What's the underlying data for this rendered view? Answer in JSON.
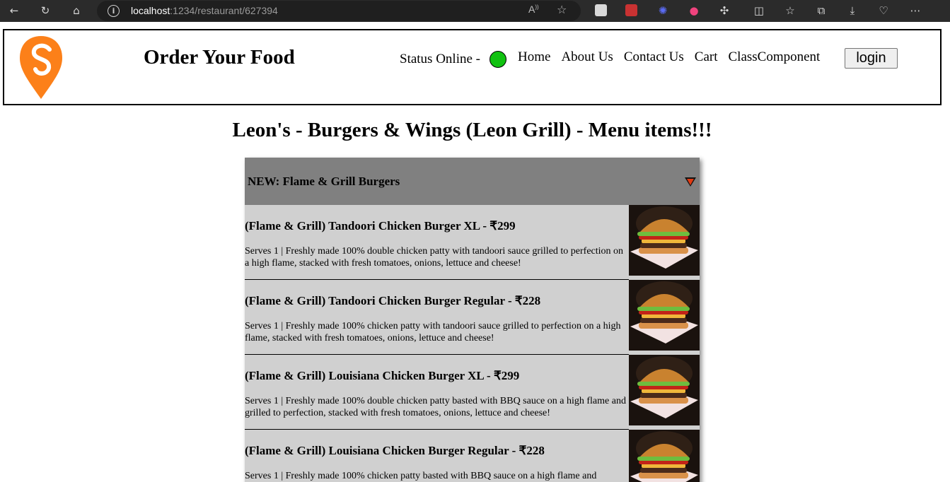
{
  "browser": {
    "url_host": "localhost",
    "url_path": ":1234/restaurant/627394",
    "reader_icon": "read-aloud-icon",
    "favorite_icon": "star-icon"
  },
  "header": {
    "logo_icon": "swiggy-logo",
    "brand_title": "Order Your Food",
    "status_text": "Status Online - ",
    "status_color": "#11c211",
    "nav": [
      "Home",
      "About Us",
      "Contact Us",
      "Cart",
      "ClassComponent"
    ],
    "login_label": "login"
  },
  "main": {
    "title": "Leon's - Burgers & Wings (Leon Grill) - Menu items!!!",
    "category": {
      "title": "NEW: Flame & Grill Burgers",
      "expanded_icon": "caret-down-icon",
      "caret_color": "#e23a12"
    },
    "items": [
      {
        "name": "(Flame & Grill) Tandoori Chicken Burger XL - ₹299",
        "description": "Serves 1 | Freshly made 100% double chicken patty with tandoori sauce grilled to perfection on a high flame, stacked with fresh tomatoes, onions, lettuce and cheese!"
      },
      {
        "name": "(Flame & Grill) Tandoori Chicken Burger Regular - ₹228",
        "description": "Serves 1 | Freshly made 100% chicken patty with tandoori sauce grilled to perfection on a high flame, stacked with fresh tomatoes, onions, lettuce and cheese!"
      },
      {
        "name": "(Flame & Grill) Louisiana Chicken Burger XL - ₹299",
        "description": "Serves 1 | Freshly made 100% double chicken patty basted with BBQ sauce on a high flame and grilled to perfection, stacked with fresh tomatoes, onions, lettuce and cheese!"
      },
      {
        "name": "(Flame & Grill) Louisiana Chicken Burger Regular - ₹228",
        "description": "Serves 1 | Freshly made 100% chicken patty basted with BBQ sauce on a high flame and"
      }
    ]
  },
  "colors": {
    "menu_bg": "#d0d0d0",
    "category_header_bg": "#808080",
    "header_border": "#000000"
  }
}
